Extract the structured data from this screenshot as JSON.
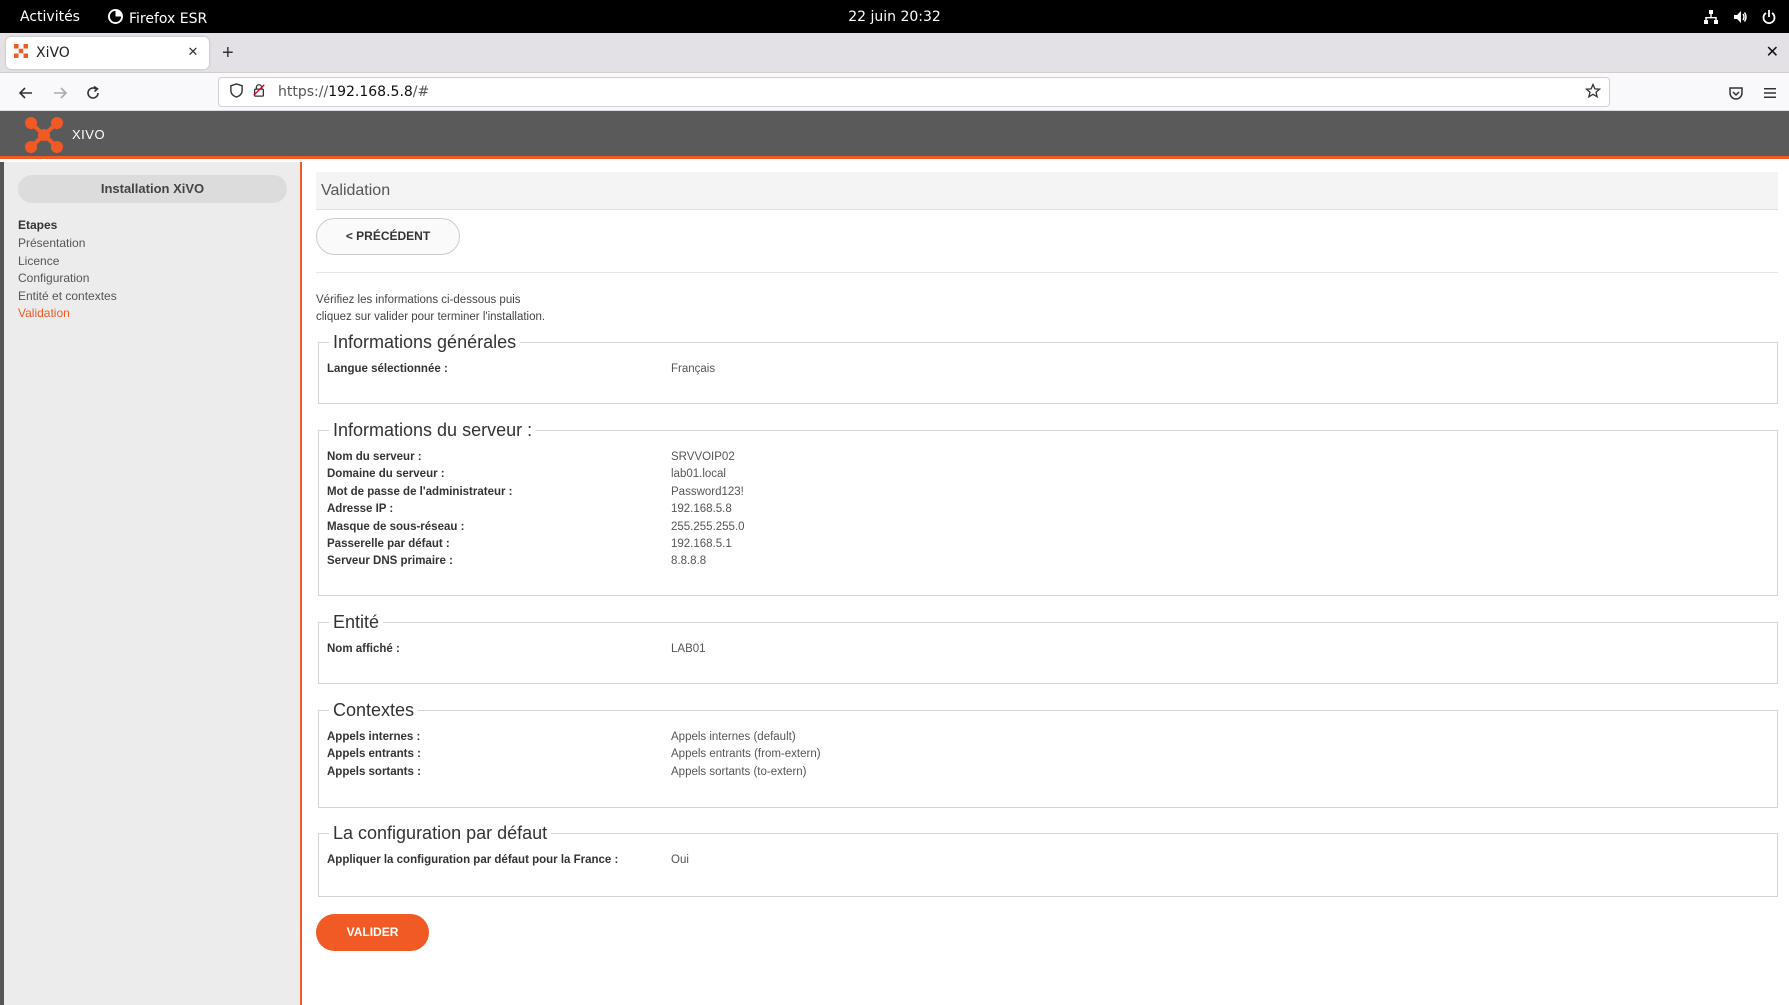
{
  "gnome": {
    "activities": "Activités",
    "app_name": "Firefox ESR",
    "clock": "22 juin  20:32"
  },
  "browser": {
    "tab_title": "XiVO",
    "url_prefix": "https://",
    "url_host": "192.168.5.8",
    "url_suffix": "/#"
  },
  "header": {
    "brand": "XIVO",
    "accent": "#f15a24"
  },
  "sidebar": {
    "title": "Installation XiVO",
    "steps_heading": "Etapes",
    "steps": [
      {
        "label": "Présentation",
        "active": false
      },
      {
        "label": "Licence",
        "active": false
      },
      {
        "label": "Configuration",
        "active": false
      },
      {
        "label": "Entité et contextes",
        "active": false
      },
      {
        "label": "Validation",
        "active": true
      }
    ]
  },
  "main": {
    "title": "Validation",
    "prev_button": "< PRÉCÉDENT",
    "intro_line1": "Vérifiez les informations ci-dessous puis",
    "intro_line2": "cliquez sur valider pour terminer l'installation.",
    "validate_button": "VALIDER",
    "sections": {
      "general": {
        "legend": "Informations générales",
        "rows": [
          {
            "k": "Langue sélectionnée :",
            "v": "Français"
          }
        ]
      },
      "server": {
        "legend": "Informations du serveur :",
        "rows": [
          {
            "k": "Nom du serveur :",
            "v": "SRVVOIP02"
          },
          {
            "k": "Domaine du serveur :",
            "v": "lab01.local"
          },
          {
            "k": "Mot de passe de l'administrateur :",
            "v": "Password123!"
          },
          {
            "k": "Adresse IP :",
            "v": "192.168.5.8"
          },
          {
            "k": "Masque de sous-réseau :",
            "v": "255.255.255.0"
          },
          {
            "k": "Passerelle par défaut :",
            "v": "192.168.5.1"
          },
          {
            "k": "Serveur DNS primaire :",
            "v": "8.8.8.8"
          }
        ]
      },
      "entity": {
        "legend": "Entité",
        "rows": [
          {
            "k": "Nom affiché :",
            "v": "LAB01"
          }
        ]
      },
      "contexts": {
        "legend": "Contextes",
        "rows": [
          {
            "k": "Appels internes :",
            "v": "Appels internes (default)"
          },
          {
            "k": "Appels entrants :",
            "v": "Appels entrants (from-extern)"
          },
          {
            "k": "Appels sortants :",
            "v": "Appels sortants (to-extern)"
          }
        ]
      },
      "default_config": {
        "legend": "La configuration par défaut",
        "rows": [
          {
            "k": "Appliquer la configuration par défaut pour la France :",
            "v": "Oui"
          }
        ]
      }
    }
  }
}
